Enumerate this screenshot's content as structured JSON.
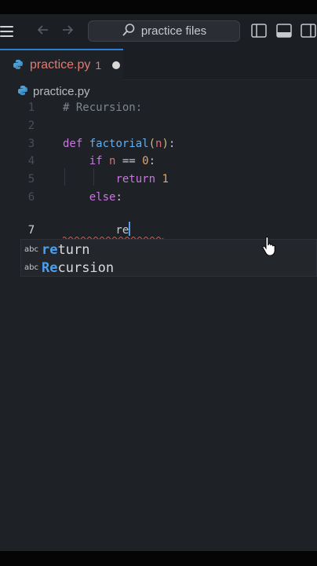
{
  "titlebar": {
    "search_text": "practice files"
  },
  "tab": {
    "label": "practice.py",
    "badge": "1"
  },
  "breadcrumb": {
    "label": "practice.py"
  },
  "editor": {
    "lines": [
      {
        "n": "1",
        "text": "# Recursion:"
      },
      {
        "n": "2",
        "text": ""
      },
      {
        "n": "3",
        "text": "def factorial(n):"
      },
      {
        "n": "4",
        "text": "    if n == 0:"
      },
      {
        "n": "5",
        "text": "        return 1"
      },
      {
        "n": "6",
        "text": "    else:"
      },
      {
        "n": "7",
        "text": "        re"
      }
    ],
    "active_line": "7"
  },
  "suggest": {
    "items": [
      {
        "kind": "abc",
        "match": "re",
        "rest": "turn"
      },
      {
        "kind": "abc",
        "match": "Re",
        "rest": "cursion"
      }
    ]
  },
  "colors": {
    "accent": "#2d7fd6",
    "error": "#e07b73",
    "background": "#1e2126"
  },
  "icons": [
    "menu-icon",
    "arrow-left-icon",
    "arrow-right-icon",
    "search-icon",
    "toggle-sidebar-icon",
    "toggle-panel-icon",
    "toggle-secondary-sidebar-icon",
    "python-file-icon",
    "unsaved-dot-icon",
    "hand-pointer-icon"
  ]
}
